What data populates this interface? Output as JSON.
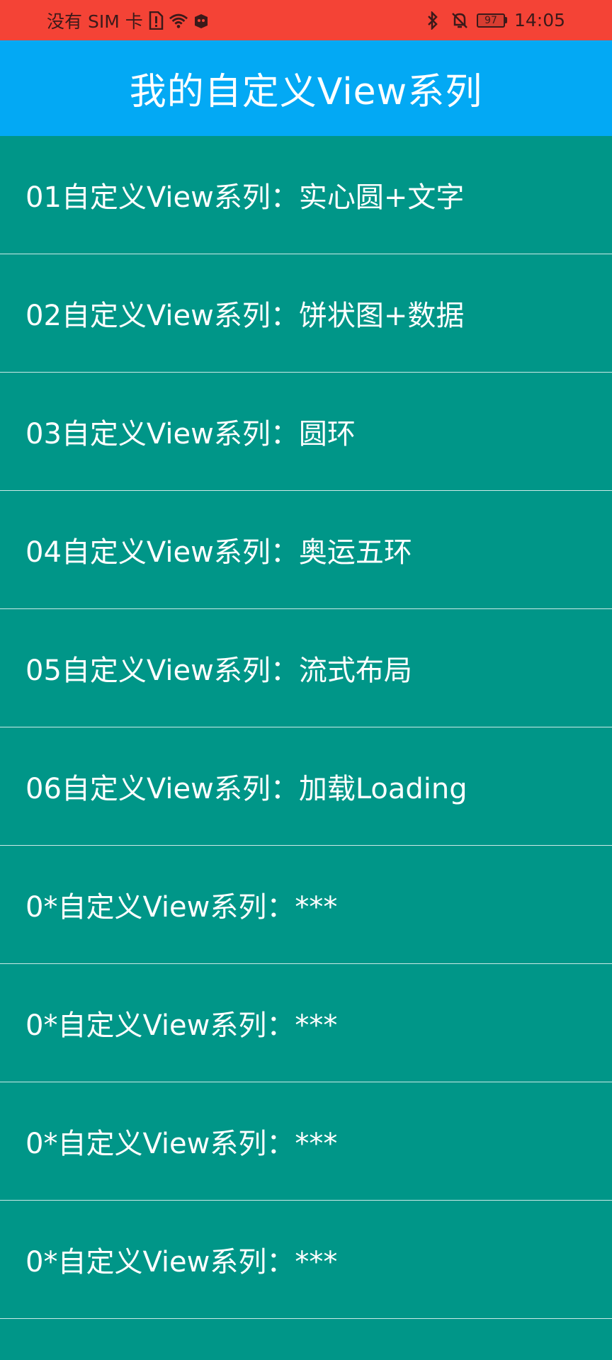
{
  "colors": {
    "status_bar": "#F44336",
    "app_bar": "#03A9F4",
    "list_background": "#009688",
    "text": "#FFFFFF"
  },
  "status_bar": {
    "carrier": "没有 SIM 卡",
    "icons_left": [
      "sim-alert-icon",
      "wifi-icon",
      "app-notification-icon"
    ],
    "icons_right": [
      "bluetooth-icon",
      "bell-off-icon"
    ],
    "battery": "97",
    "time": "14:05"
  },
  "app_bar": {
    "title": "我的自定义View系列"
  },
  "list": {
    "items": [
      {
        "label": "01自定义View系列：实心圆+文字"
      },
      {
        "label": "02自定义View系列：饼状图+数据"
      },
      {
        "label": "03自定义View系列：圆环"
      },
      {
        "label": "04自定义View系列：奥运五环"
      },
      {
        "label": "05自定义View系列：流式布局"
      },
      {
        "label": "06自定义View系列：加载Loading"
      },
      {
        "label": "0*自定义View系列：***"
      },
      {
        "label": "0*自定义View系列：***"
      },
      {
        "label": "0*自定义View系列：***"
      },
      {
        "label": "0*自定义View系列：***"
      }
    ]
  }
}
